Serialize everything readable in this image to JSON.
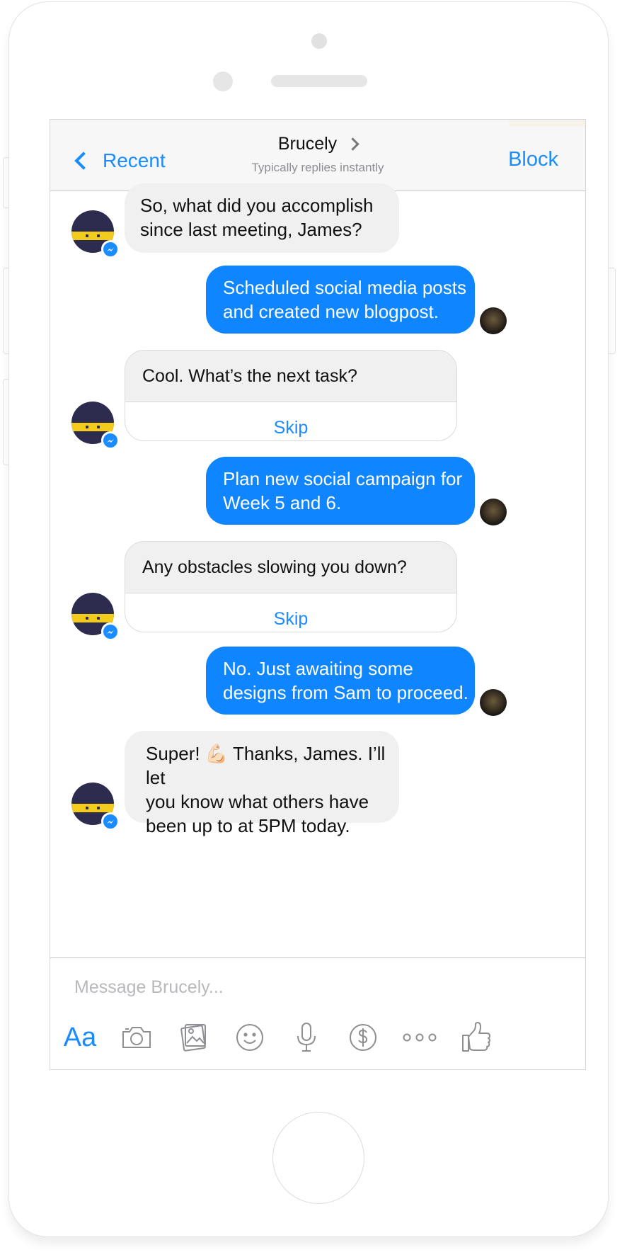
{
  "header": {
    "back_label": "Recent",
    "title": "Brucely",
    "subtitle": "Typically replies instantly",
    "block_label": "Block"
  },
  "messages": [
    {
      "from": "bot",
      "text_lines": [
        "So, what did you accomplish",
        "since last meeting, James?"
      ]
    },
    {
      "from": "user",
      "text_lines": [
        "Scheduled social media posts",
        "and created new blogpost."
      ]
    },
    {
      "from": "bot",
      "question": "Cool. What’s the next task?",
      "option": "Skip"
    },
    {
      "from": "user",
      "text_lines": [
        "Plan new social campaign for",
        "Week 5 and 6."
      ]
    },
    {
      "from": "bot",
      "question": "Any obstacles slowing you down?",
      "option": "Skip"
    },
    {
      "from": "user",
      "text_lines": [
        "No. Just awaiting some",
        "designs from Sam to proceed."
      ]
    },
    {
      "from": "bot",
      "text_lines": [
        "Super! 💪🏻 Thanks, James. I’ll let",
        "you know what others have",
        "been up to at 5PM today."
      ]
    }
  ],
  "composer": {
    "placeholder": "Message Brucely...",
    "aa_label": "Aa",
    "tools": [
      "camera-icon",
      "photo-gallery-icon",
      "emoji-icon",
      "microphone-icon",
      "payment-icon",
      "more-icon",
      "thumbs-up-icon"
    ]
  },
  "colors": {
    "accent": "#1a8cff",
    "outgoing_bubble": "#0f85ff",
    "incoming_bubble": "#f0f0f0",
    "bot_avatar": "#2e2c4e",
    "bot_band": "#f2cb1d"
  }
}
